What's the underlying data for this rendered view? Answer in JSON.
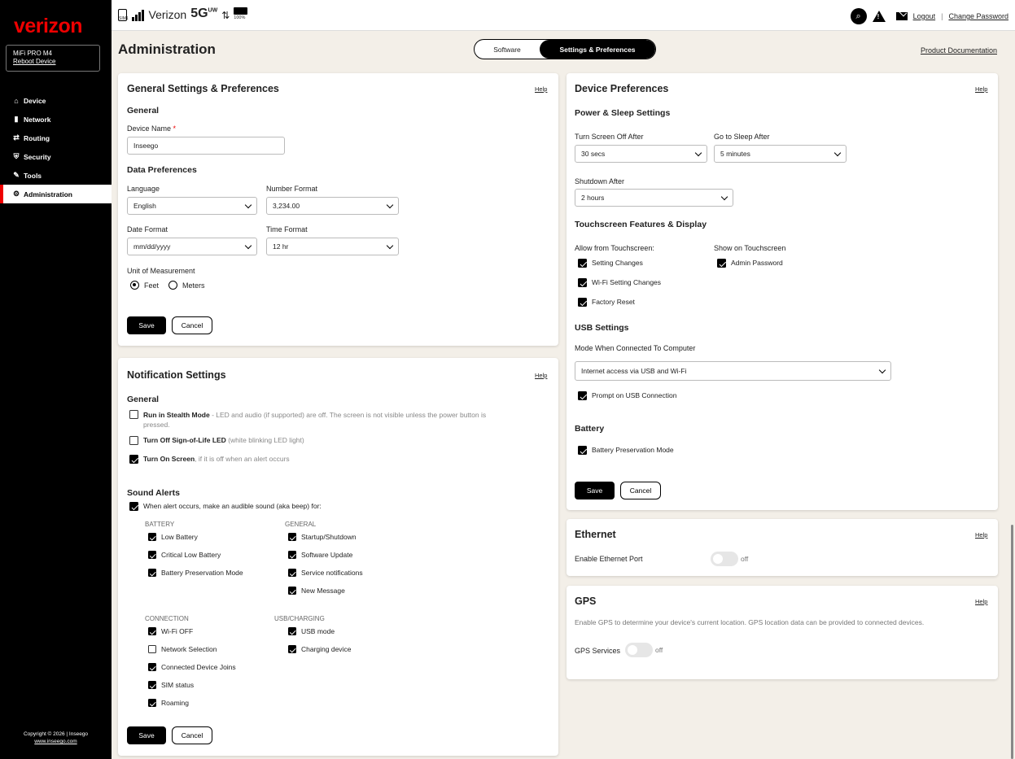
{
  "sidebar": {
    "logo": "verizon",
    "device_name": "MiFi PRO M4",
    "reboot_link": "Reboot Device",
    "items": [
      {
        "label": "Device",
        "icon": "home-icon"
      },
      {
        "label": "Network",
        "icon": "signal-icon"
      },
      {
        "label": "Routing",
        "icon": "routing-icon"
      },
      {
        "label": "Security",
        "icon": "shield-icon"
      },
      {
        "label": "Tools",
        "icon": "wrench-icon"
      },
      {
        "label": "Administration",
        "icon": "gear-icon",
        "active": true
      }
    ],
    "copyright": "Copyright © 2026 | Inseego",
    "copyright_link": "www.inseego.com"
  },
  "topbar": {
    "sim_label": "SIM1",
    "carrier": "Verizon",
    "network_type": "5G",
    "network_sup": "UW",
    "battery": "100%",
    "logout": "Logout",
    "change_password": "Change Password"
  },
  "page": {
    "title": "Administration",
    "tabs": [
      "Software",
      "Settings & Preferences"
    ],
    "active_tab": "Settings & Preferences",
    "product_doc": "Product Documentation"
  },
  "general_settings": {
    "title": "General Settings & Preferences",
    "help": "Help",
    "general_heading": "General",
    "device_name_label": "Device Name",
    "required_mark": "*",
    "device_name_value": "Inseego",
    "data_pref_heading": "Data Preferences",
    "language_label": "Language",
    "language_value": "English",
    "number_format_label": "Number Format",
    "number_format_value": "3,234.00",
    "date_format_label": "Date Format",
    "date_format_value": "mm/dd/yyyy",
    "time_format_label": "Time Format",
    "time_format_value": "12 hr",
    "unit_label": "Unit of Measurement",
    "unit_feet": "Feet",
    "unit_meters": "Meters",
    "unit_selected": "Feet",
    "save": "Save",
    "cancel": "Cancel"
  },
  "notifications": {
    "title": "Notification Settings",
    "help": "Help",
    "general_heading": "General",
    "stealth_bold": "Run in Stealth Mode",
    "stealth_rest": " - LED and audio (if supported) are off. The screen is not visible unless the power button is",
    "stealth_rest2": "pressed.",
    "sol_bold": "Turn Off Sign-of-Life LED",
    "sol_rest": " (white blinking LED light)",
    "screen_bold": "Turn On Screen",
    "screen_rest": ", if it is off when an alert occurs",
    "sound_heading": "Sound Alerts",
    "sound_main": "When alert occurs, make an audible sound (aka beep) for:",
    "battery_group": "BATTERY",
    "battery_items": [
      "Low Battery",
      "Critical Low Battery",
      "Battery Preservation Mode"
    ],
    "general_group": "GENERAL",
    "general_items": [
      "Startup/Shutdown",
      "Software Update",
      "Service notifications",
      "New Message"
    ],
    "connection_group": "CONNECTION",
    "connection_items": [
      "Wi-Fi OFF",
      "Network Selection",
      "Connected Device Joins",
      "SIM status",
      "Roaming"
    ],
    "usb_group": "USB/CHARGING",
    "usb_items": [
      "USB mode",
      "Charging device"
    ],
    "save": "Save",
    "cancel": "Cancel"
  },
  "device_prefs": {
    "title": "Device Preferences",
    "help": "Help",
    "power_heading": "Power & Sleep Settings",
    "screen_off_label": "Turn Screen Off After",
    "screen_off_value": "30 secs",
    "sleep_label": "Go to Sleep After",
    "sleep_value": "5 minutes",
    "shutdown_label": "Shutdown After",
    "shutdown_value": "2 hours",
    "touch_heading": "Touchscreen Features & Display",
    "allow_label": "Allow from Touchscreen:",
    "allow_items": [
      "Setting Changes",
      "Wi-Fi Setting Changes",
      "Factory Reset"
    ],
    "show_label": "Show on Touchscreen",
    "show_items": [
      "Admin Password"
    ],
    "usb_heading": "USB Settings",
    "usb_mode_label": "Mode When Connected To Computer",
    "usb_mode_value": "Internet access via USB and Wi-Fi",
    "usb_prompt": "Prompt on USB Connection",
    "battery_heading": "Battery",
    "battery_pres": "Battery Preservation Mode",
    "save": "Save",
    "cancel": "Cancel"
  },
  "ethernet": {
    "title": "Ethernet",
    "help": "Help",
    "label": "Enable Ethernet Port",
    "state": "off"
  },
  "gps": {
    "title": "GPS",
    "help": "Help",
    "desc": "Enable GPS to determine your device's current location. GPS location data can be provided to connected devices.",
    "label": "GPS Services",
    "state": "off"
  },
  "colors": {
    "brand": "#e00000",
    "sidebar_bg": "#000000",
    "page_bg": "#f3efe8"
  }
}
